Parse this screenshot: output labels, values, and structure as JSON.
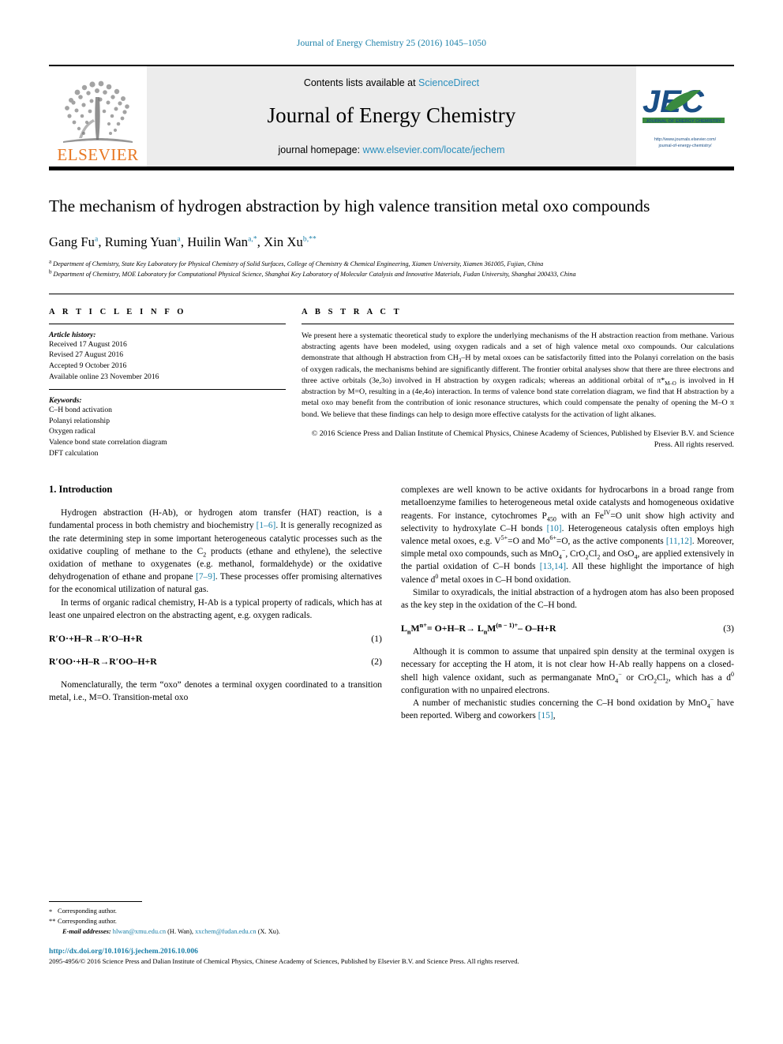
{
  "running_head": "Journal of Energy Chemistry 25 (2016) 1045–1050",
  "masthead": {
    "elsevier_wordmark": "ELSEVIER",
    "contents_prefix": "Contents lists available at ",
    "contents_link": "ScienceDirect",
    "journal_title": "Journal of Energy Chemistry",
    "homepage_prefix": "journal homepage: ",
    "homepage_url": "www.elsevier.com/locate/jechem",
    "jec_logo_text": "JEC",
    "jec_logo_subtitle": "JOURNAL OF ENERGY CHEMISTRY",
    "jec_url_line1": "http://www.journals.elsevier.com/",
    "jec_url_line2": "journal-of-energy-chemistry/"
  },
  "article": {
    "title": "The mechanism of hydrogen abstraction by high valence transition metal oxo compounds",
    "authors_html": "Gang Fu<sup>a</sup>, Ruming Yuan<sup>a</sup>, Huilin Wan<sup>a,*</sup>, Xin Xu<sup>b,**</sup>",
    "affiliation_a": "Department of Chemistry, State Key Laboratory for Physical Chemistry of Solid Surfaces, College of Chemistry & Chemical Engineering, Xiamen University, Xiamen 361005, Fujian, China",
    "affiliation_b": "Department of Chemistry, MOE Laboratory for Computational Physical Science, Shanghai Key Laboratory of Molecular Catalysis and Innovative Materials, Fudan University, Shanghai 200433, China"
  },
  "info": {
    "heading": "A R T I C L E    I N F O",
    "history_label": "Article history:",
    "history": [
      "Received 17 August 2016",
      "Revised 27 August 2016",
      "Accepted 9 October 2016",
      "Available online 23 November 2016"
    ],
    "keywords_label": "Keywords:",
    "keywords": [
      "C–H bond activation",
      "Polanyi relationship",
      "Oxygen radical",
      "Valence bond state correlation diagram",
      "DFT calculation"
    ]
  },
  "abstract": {
    "heading": "A B S T R A C T",
    "text_html": "We present here a systematic theoretical study to explore the underlying mechanisms of the H abstraction reaction from methane. Various abstracting agents have been modeled, using oxygen radicals and a set of high valence metal oxo compounds. Our calculations demonstrate that although H abstraction from CH<sub>3</sub>–H by metal oxoes can be satisfactorily fitted into the Polanyi correlation on the basis of oxygen radicals, the mechanisms behind are significantly different. The frontier orbital analyses show that there are three electrons and three active orbitals (3e,3o) involved in H abstraction by oxygen radicals; whereas an additional orbital of &pi;*<sub>M–O</sub> is involved in H abstraction by M&#61;O, resulting in a (4e,4o) interaction. In terms of valence bond state correlation diagram, we find that H abstraction by a metal oxo may benefit from the contribution of ionic resonance structures, which could compensate the penalty of opening the M–O &pi; bond. We believe that these findings can help to design more effective catalysts for the activation of light alkanes.",
    "copyright": "© 2016 Science Press and Dalian Institute of Chemical Physics, Chinese Academy of Sciences, Published by Elsevier B.V. and Science Press. All rights reserved."
  },
  "body": {
    "section1_heading": "1.  Introduction",
    "left": {
      "p1_html": "Hydrogen abstraction (H-Ab), or hydrogen atom transfer (HAT) reaction, is a fundamental process in both chemistry and biochemistry <span class=\"ref\">[1–6]</span>. It is generally recognized as the rate determining step in some important heterogeneous catalytic processes such as the oxidative coupling of methane to the C<sub>2</sub> products (ethane and ethylene), the selective oxidation of methane to oxygenates (e.g. methanol, formaldehyde) or the oxidative dehydrogenation of ethane and propane <span class=\"ref\">[7–9]</span>. These processes offer promising alternatives for the economical utilization of natural gas.",
      "p2_html": "In terms of organic radical chemistry, H-Ab is a typical property of radicals, which has at least one unpaired electron on the abstracting agent, e.g. oxygen radicals.",
      "eq1_html": "R&prime;O&middot;+H–R&rarr;R&prime;O–H+R",
      "eq1_num": "(1)",
      "eq2_html": "R&prime;OO&middot;+H–R&rarr;R&prime;OO–H+R",
      "eq2_num": "(2)",
      "p3_html": "Nomenclaturally, the term &ldquo;oxo&rdquo; denotes a terminal oxygen coordinated to a transition metal, i.e., M&#61;O. Transition-metal oxo"
    },
    "right": {
      "p1_html": "complexes are well known to be active oxidants for hydrocarbons in a broad range from metalloenzyme families to heterogeneous metal oxide catalysts and homogeneous oxidative reagents. For instance, cytochromes P<sub>450</sub> with an Fe<sup>IV</sup>&#61;O unit show high activity and selectivity to hydroxylate C–H bonds <span class=\"ref\">[10]</span>. Heterogeneous catalysis often employs high valence metal oxoes, e.g. V<sup>5+</sup>&#61;O and Mo<sup>6+</sup>&#61;O, as the active components <span class=\"ref\">[11,12]</span>. Moreover, simple metal oxo compounds, such as MnO<sub>4</sub><sup>−</sup>, CrO<sub>2</sub>Cl<sub>2</sub> and OsO<sub>4</sub>, are applied extensively in the partial oxidation of C–H bonds <span class=\"ref\">[13,14]</span>. All these highlight the importance of high valence d<sup>0</sup> metal oxoes in C–H bond oxidation.",
      "p2_html": "Similar to oxyradicals, the initial abstraction of a hydrogen atom has also been proposed as the key step in the oxidation of the C–H bond.",
      "eq3_html": "L<sub>n</sub>M<sup>n+</sup>&#61; O+H–R&rarr; L<sub>n</sub>M<sup>(n − 1)+</sup>– O–H+R",
      "eq3_num": "(3)",
      "p3_html": "Although it is common to assume that unpaired spin density at the terminal oxygen is necessary for accepting the H atom, it is not clear how H-Ab really happens on a closed-shell high valence oxidant, such as permanganate MnO<sub>4</sub><sup>−</sup> or CrO<sub>2</sub>Cl<sub>2</sub>, which has a d<sup>0</sup> configuration with no unpaired electrons.",
      "p4_html": "A number of mechanistic studies concerning the C–H bond oxidation by MnO<sub>4</sub><sup>−</sup> have been reported. Wiberg and coworkers <span class=\"ref\">[15]</span>,"
    }
  },
  "footnotes": {
    "corresponding_1_marker": "*",
    "corresponding_1": "Corresponding author.",
    "corresponding_2_marker": "**",
    "corresponding_2": "Corresponding author.",
    "email_label": "E-mail addresses:",
    "email_1": "hlwan@xmu.edu.cn",
    "email_1_owner": "(H. Wan),",
    "email_2": "xxchem@fudan.edu.cn",
    "email_2_owner": "(X. Xu)."
  },
  "bottom": {
    "doi": "http://dx.doi.org/10.1016/j.jechem.2016.10.006",
    "issn_line": "2095-4956/© 2016 Science Press and Dalian Institute of Chemical Physics, Chinese Academy of Sciences, Published by Elsevier B.V. and Science Press. All rights reserved."
  },
  "colors": {
    "link": "#1a7fa8",
    "elsevier_orange": "#E87722",
    "jec_blue": "#1a4f86",
    "jec_green": "#3a8a3f",
    "masthead_bg": "#ececec"
  }
}
